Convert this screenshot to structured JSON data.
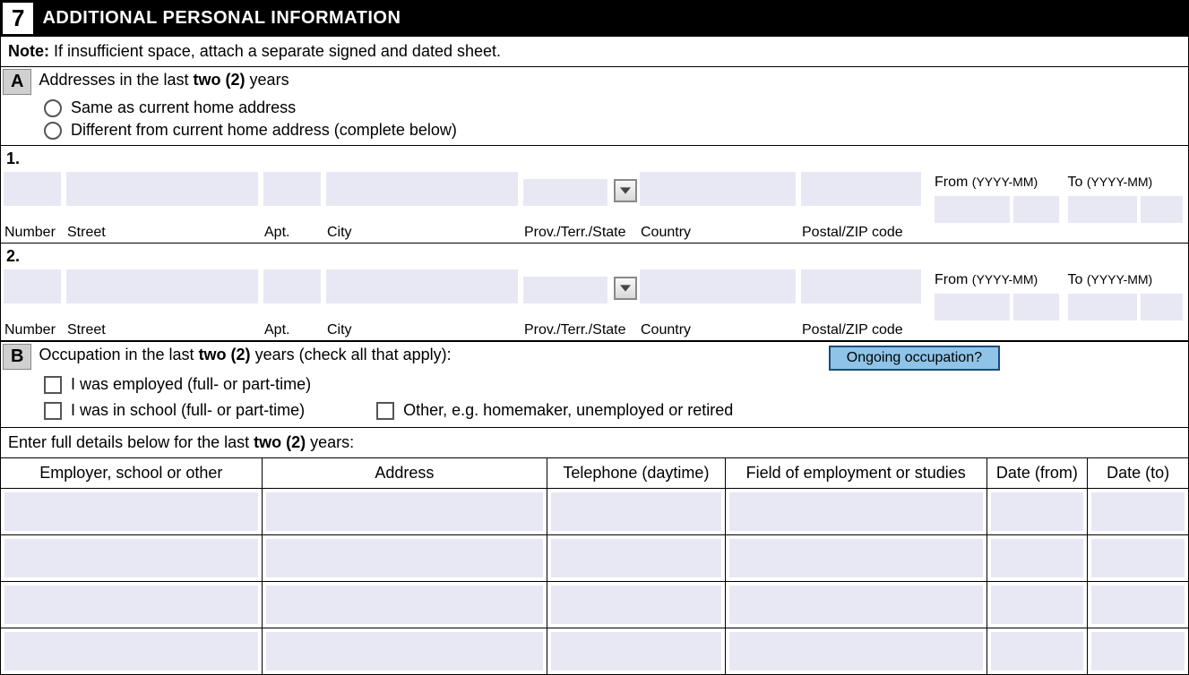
{
  "section": {
    "number": "7",
    "title": "ADDITIONAL PERSONAL INFORMATION"
  },
  "note": {
    "label": "Note:",
    "text": " If insufficient space, attach a separate signed and dated sheet."
  },
  "subA": {
    "letter": "A",
    "text_pre": "Addresses in the last ",
    "text_bold": "two (2)",
    "text_post": " years",
    "radio1": "Same as current home address",
    "radio2": "Different from current home address (complete below)"
  },
  "addr_labels": {
    "number": "Number",
    "street": "Street",
    "apt": "Apt.",
    "city": "City",
    "prov": "Prov./Terr./State",
    "country": "Country",
    "postal": "Postal/ZIP code",
    "from": "From ",
    "from_fmt": "(YYYY-MM)",
    "to": "To ",
    "to_fmt": "(YYYY-MM)"
  },
  "addr_rows": {
    "r1": "1.",
    "r2": "2."
  },
  "subB": {
    "letter": "B",
    "text_pre": "Occupation in the last ",
    "text_bold": "two (2)",
    "text_post": " years (check all that apply):",
    "ongoing": "Ongoing occupation?",
    "chk1": "I was employed (full- or part-time)",
    "chk2": "I was in school (full- or part-time)",
    "chk3": "Other, e.g. homemaker, unemployed or retired"
  },
  "details": {
    "intro_pre": "Enter full details below for the last ",
    "intro_bold": "two (2)",
    "intro_post": " years:",
    "h1": "Employer, school or other",
    "h2": "Address",
    "h3": "Telephone (daytime)",
    "h4": "Field of employment or studies",
    "h5": "Date (from)",
    "h6": "Date (to)"
  }
}
